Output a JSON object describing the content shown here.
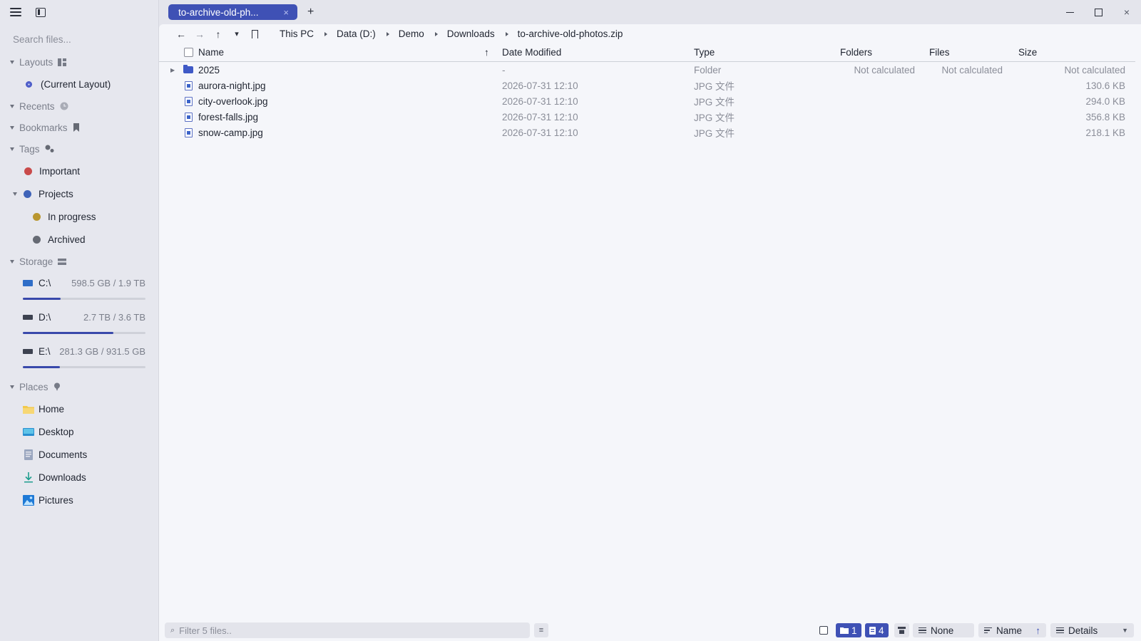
{
  "sidebar": {
    "search_placeholder": "Search files...",
    "layouts": {
      "label": "Layouts",
      "items": [
        "(Current Layout)"
      ]
    },
    "recents": {
      "label": "Recents"
    },
    "bookmarks": {
      "label": "Bookmarks"
    },
    "tags": {
      "label": "Tags",
      "items": [
        {
          "label": "Important",
          "color": "#c94a4a"
        },
        {
          "label": "Projects",
          "color": "#3f63b8"
        },
        {
          "label": "In progress",
          "color": "#b9962f"
        },
        {
          "label": "Archived",
          "color": "#666a74"
        }
      ]
    },
    "storage": {
      "label": "Storage",
      "drives": [
        {
          "name": "C:\\",
          "size": "598.5 GB / 1.9 TB",
          "used_fraction": 0.31
        },
        {
          "name": "D:\\",
          "size": "2.7 TB / 3.6 TB",
          "used_fraction": 0.74
        },
        {
          "name": "E:\\",
          "size": "281.3 GB / 931.5 GB",
          "used_fraction": 0.3
        }
      ]
    },
    "places": {
      "label": "Places",
      "items": [
        {
          "label": "Home",
          "icon": "folder-icon"
        },
        {
          "label": "Desktop",
          "icon": "desktop-icon"
        },
        {
          "label": "Documents",
          "icon": "document-icon"
        },
        {
          "label": "Downloads",
          "icon": "download-icon"
        },
        {
          "label": "Pictures",
          "icon": "picture-icon"
        }
      ]
    }
  },
  "tab": {
    "title": "to-archive-old-ph...",
    "close": "×",
    "new": "+"
  },
  "window": {
    "close": "×"
  },
  "nav": {
    "back": "←",
    "forward": "→",
    "up": "↑",
    "history": "▾"
  },
  "breadcrumb": [
    "This PC",
    "Data (D:)",
    "Demo",
    "Downloads",
    "to-archive-old-photos.zip"
  ],
  "columns": {
    "name": "Name",
    "sort_arrow": "↑",
    "date": "Date Modified",
    "type": "Type",
    "folders": "Folders",
    "files": "Files",
    "size": "Size"
  },
  "rows": [
    {
      "name": "2025",
      "kind": "folder",
      "date": "-",
      "type": "Folder",
      "folders": "Not calculated",
      "files": "Not calculated",
      "size": "Not calculated"
    },
    {
      "name": "aurora-night.jpg",
      "kind": "file",
      "date": "2026-07-31 12:10",
      "type": "JPG 文件",
      "folders": "",
      "files": "",
      "size": "130.6 KB"
    },
    {
      "name": "city-overlook.jpg",
      "kind": "file",
      "date": "2026-07-31 12:10",
      "type": "JPG 文件",
      "folders": "",
      "files": "",
      "size": "294.0 KB"
    },
    {
      "name": "forest-falls.jpg",
      "kind": "file",
      "date": "2026-07-31 12:10",
      "type": "JPG 文件",
      "folders": "",
      "files": "",
      "size": "356.8 KB"
    },
    {
      "name": "snow-camp.jpg",
      "kind": "file",
      "date": "2026-07-31 12:10",
      "type": "JPG 文件",
      "folders": "",
      "files": "",
      "size": "218.1 KB"
    }
  ],
  "statusbar": {
    "filter_placeholder": "Filter 5 files..",
    "folder_count": "1",
    "file_count": "4",
    "group_by": "None",
    "sort_by": "Name",
    "sort_dir": "↑",
    "view": "Details"
  },
  "colors": {
    "accent": "#3f51b5",
    "sidebar_bg": "#e6e7ee",
    "content_bg": "#f5f6fa"
  }
}
